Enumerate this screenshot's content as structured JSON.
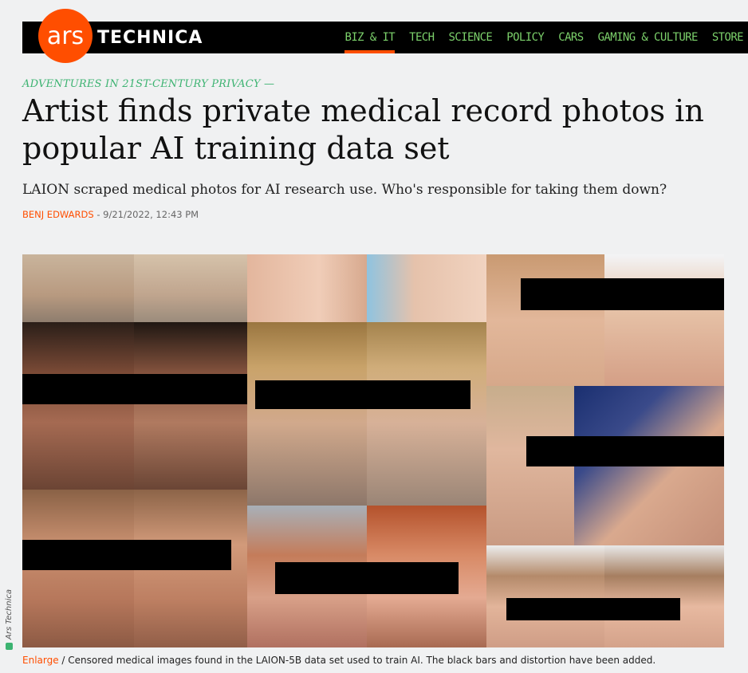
{
  "brand": {
    "logo_mark": "ars",
    "logo_text": "TECHNICA",
    "accent": "#ff4e00",
    "nav_color": "#7cd16b"
  },
  "nav": {
    "items": [
      {
        "label": "BIZ & IT",
        "active": true
      },
      {
        "label": "TECH"
      },
      {
        "label": "SCIENCE"
      },
      {
        "label": "POLICY"
      },
      {
        "label": "CARS"
      },
      {
        "label": "GAMING & CULTURE"
      },
      {
        "label": "STORE"
      }
    ]
  },
  "article": {
    "kicker": "ADVENTURES IN 21ST-CENTURY PRIVACY —",
    "title": "Artist finds private medical record photos in popular AI training data set",
    "dek": "LAION scraped medical photos for AI research use. Who's responsible for taking them down?",
    "author": "BENJ EDWARDS",
    "byline_sep": " - ",
    "date": "9/21/2022, 12:43 PM"
  },
  "image": {
    "credit": "Ars Technica",
    "caption_link": "Enlarge",
    "caption_text": " / Censored medical images found in the LAION-5B data set used to train AI. The black bars and distortion have been added."
  }
}
